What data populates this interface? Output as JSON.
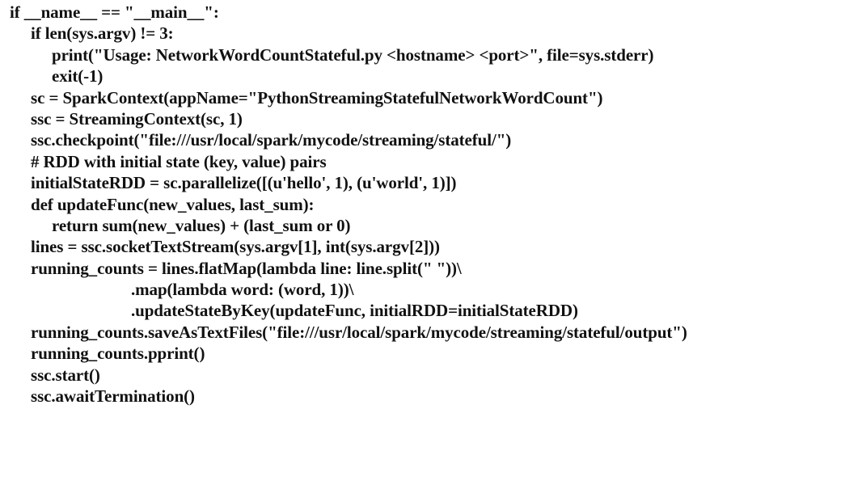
{
  "document": {
    "language": "python",
    "lines": [
      {
        "indent": 0,
        "text": "if __name__ == \"__main__\":"
      },
      {
        "indent": 1,
        "text": "if len(sys.argv) != 3:"
      },
      {
        "indent": 2,
        "text": "print(\"Usage: NetworkWordCountStateful.py <hostname> <port>\", file=sys.stderr)"
      },
      {
        "indent": 2,
        "text": "exit(-1)"
      },
      {
        "indent": 1,
        "text": "sc = SparkContext(appName=\"PythonStreamingStatefulNetworkWordCount\")"
      },
      {
        "indent": 1,
        "text": "ssc = StreamingContext(sc, 1)"
      },
      {
        "indent": 1,
        "text": "ssc.checkpoint(\"file:///usr/local/spark/mycode/streaming/stateful/\")"
      },
      {
        "indent": 1,
        "text": "# RDD with initial state (key, value) pairs"
      },
      {
        "indent": 1,
        "text": "initialStateRDD = sc.parallelize([(u'hello', 1), (u'world', 1)])"
      },
      {
        "indent": 1,
        "text": "def updateFunc(new_values, last_sum):"
      },
      {
        "indent": 2,
        "text": "return sum(new_values) + (last_sum or 0)"
      },
      {
        "indent": 1,
        "text": "lines = ssc.socketTextStream(sys.argv[1], int(sys.argv[2]))"
      },
      {
        "indent": 1,
        "text": "running_counts = lines.flatMap(lambda line: line.split(\" \"))\\"
      },
      {
        "indent": 3,
        "text": ".map(lambda word: (word, 1))\\"
      },
      {
        "indent": 3,
        "text": ".updateStateByKey(updateFunc, initialRDD=initialStateRDD)"
      },
      {
        "indent": 1,
        "text": "running_counts.saveAsTextFiles(\"file:///usr/local/spark/mycode/streaming/stateful/output\")"
      },
      {
        "indent": 1,
        "text": "running_counts.pprint()"
      },
      {
        "indent": 1,
        "text": "ssc.start()"
      },
      {
        "indent": 1,
        "text": "ssc.awaitTermination()"
      }
    ]
  }
}
